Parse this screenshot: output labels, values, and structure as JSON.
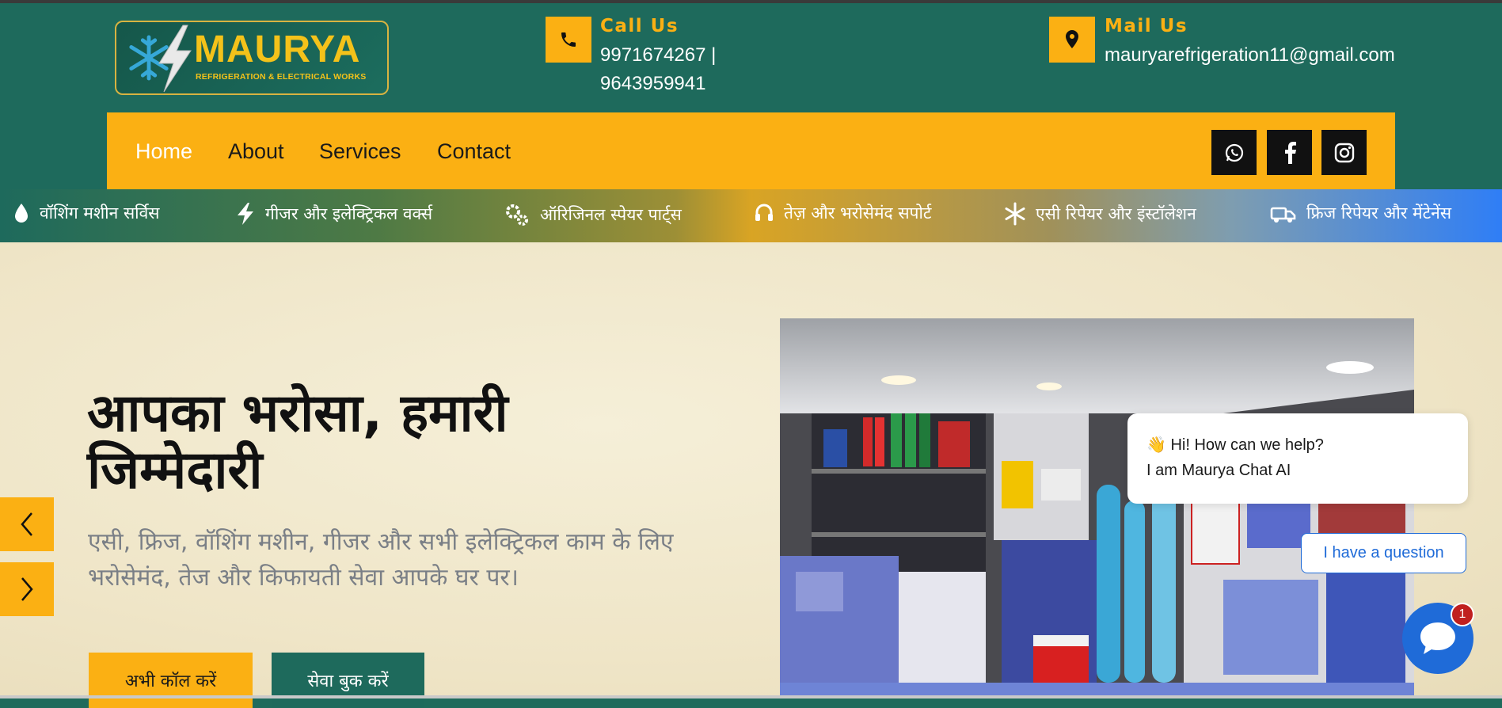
{
  "brand": {
    "name": "MAURYA",
    "tagline": "REFRIGERATION & ELECTRICAL WORKS",
    "primary_color": "#1e6a5c",
    "accent_color": "#fbb013"
  },
  "contact": {
    "call": {
      "title": "Call Us",
      "line1": "9971674267 |",
      "line2": "9643959941",
      "icon": "phone-icon"
    },
    "mail": {
      "title": "Mail Us",
      "email": "mauryarefrigeration11@gmail.com",
      "icon": "map-pin-icon"
    }
  },
  "nav": {
    "items": [
      {
        "label": "Home",
        "active": true
      },
      {
        "label": "About"
      },
      {
        "label": "Services"
      },
      {
        "label": "Contact"
      }
    ],
    "social": [
      "whatsapp-icon",
      "facebook-icon",
      "instagram-icon"
    ]
  },
  "ticker": {
    "items": [
      {
        "label": "वॉशिंग मशीन सर्विस",
        "icon": "water-drop-icon"
      },
      {
        "label": "गीजर और इलेक्ट्रिकल वर्क्स",
        "icon": "lightning-icon"
      },
      {
        "label": "ऑरिजिनल स्पेयर पार्ट्स",
        "icon": "gears-icon"
      },
      {
        "label": "तेज़ और भरोसेमंद सपोर्ट",
        "icon": "headset-icon"
      },
      {
        "label": "एसी रिपेयर और इंस्टॉलेशन",
        "icon": "snowflake-icon"
      },
      {
        "label": "फ्रिज रिपेयर और मेंटेनेंस",
        "icon": "truck-icon"
      }
    ]
  },
  "hero": {
    "title_line1": "आपका भरोसा, हमारी",
    "title_line2": "जिम्मेदारी",
    "subtitle_line1": "एसी, फ्रिज, वॉशिंग मशीन, गीजर और सभी इलेक्ट्रिकल काम के लिए",
    "subtitle_line2": "भरोसेमंद, तेज और किफायती सेवा आपके घर पर।",
    "call_button": "अभी कॉल करें",
    "book_button": "सेवा बुक करें"
  },
  "chat": {
    "greeting": "👋 Hi! How can we help?",
    "intro": "I am Maurya Chat AI",
    "question_button": "I have a question",
    "badge_count": "1"
  }
}
